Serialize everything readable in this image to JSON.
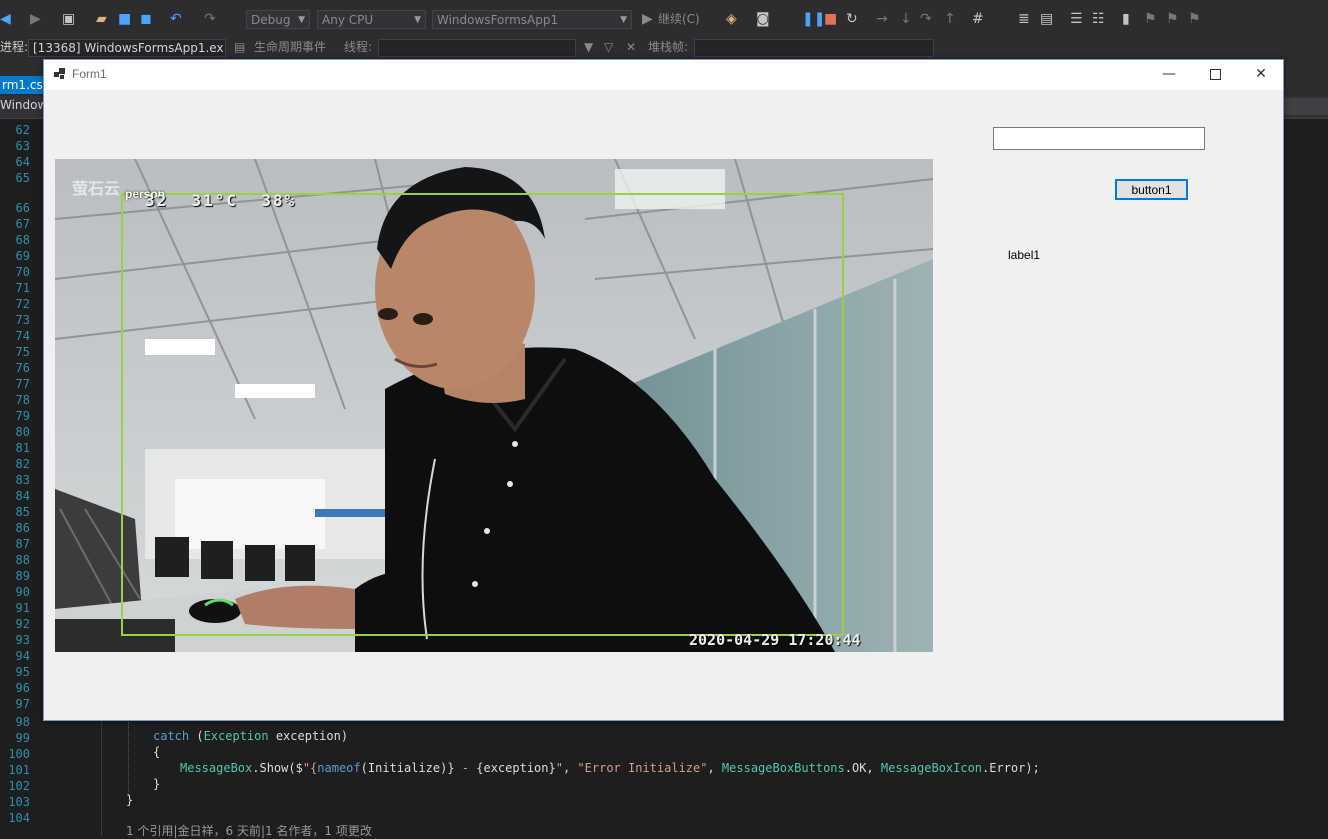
{
  "vs": {
    "config": "Debug",
    "platform": "Any CPU",
    "startup_project": "WindowsFormsApp1",
    "continue_label": "继续(C)",
    "process_label": "进程:",
    "process_value": "[13368] WindowsFormsApp1.ex",
    "lifecycle_label": "生命周期事件",
    "thread_label": "线程:",
    "stackframe_label": "堆栈帧:",
    "doc_tab": "rm1.cs",
    "nav_project": "Window"
  },
  "editor": {
    "line_numbers": [
      "62",
      "63",
      "64",
      "65",
      "66",
      "67",
      "68",
      "69",
      "70",
      "71",
      "72",
      "73",
      "74",
      "75",
      "76",
      "77",
      "78",
      "79",
      "80",
      "81",
      "82",
      "83",
      "84",
      "85",
      "86",
      "87",
      "88",
      "89",
      "90",
      "91",
      "92",
      "93",
      "94",
      "95",
      "96",
      "97",
      "98",
      "99",
      "100",
      "101",
      "102",
      "103",
      "104"
    ],
    "code": {
      "catch_kw": "catch",
      "catch_open": " (",
      "catch_type": "Exception",
      "catch_rest": " exception)",
      "brace_open": "{",
      "msg_type": "MessageBox",
      "msg_call": ".Show($",
      "msg_str1": "\"{",
      "msg_nameof": "nameof",
      "msg_mid": "(Initialize)}",
      "msg_str2": " - ",
      "msg_exc": "{exception}",
      "msg_str3": "\"",
      "msg_args_sep": ", ",
      "msg_str4": "\"Error Initialize\"",
      "msg_buttons_type": "MessageBoxButtons",
      "msg_buttons_rest": ".OK, ",
      "msg_icon_type": "MessageBoxIcon",
      "msg_icon_rest": ".Error);",
      "brace_close": "}",
      "brace_close2": "}",
      "codelens": "1 个引用|金日祥，6 天前|1 名作者，1 项更改"
    }
  },
  "form": {
    "title": "Form1",
    "textbox1_value": "",
    "button1_label": "button1",
    "label1_text": "label1"
  },
  "camera": {
    "detection_label": "person",
    "logo_text": "萤石云",
    "osd_top": "32  31°C  38%",
    "osd_timestamp": "2020-04-29 17:20:44"
  },
  "colors": {
    "vs_background": "#1e1e1e",
    "vs_toolbar": "#2d2d30",
    "accent_blue": "#007acc",
    "detection_box": "#9ad23f",
    "form_background": "#f0f0f0"
  }
}
